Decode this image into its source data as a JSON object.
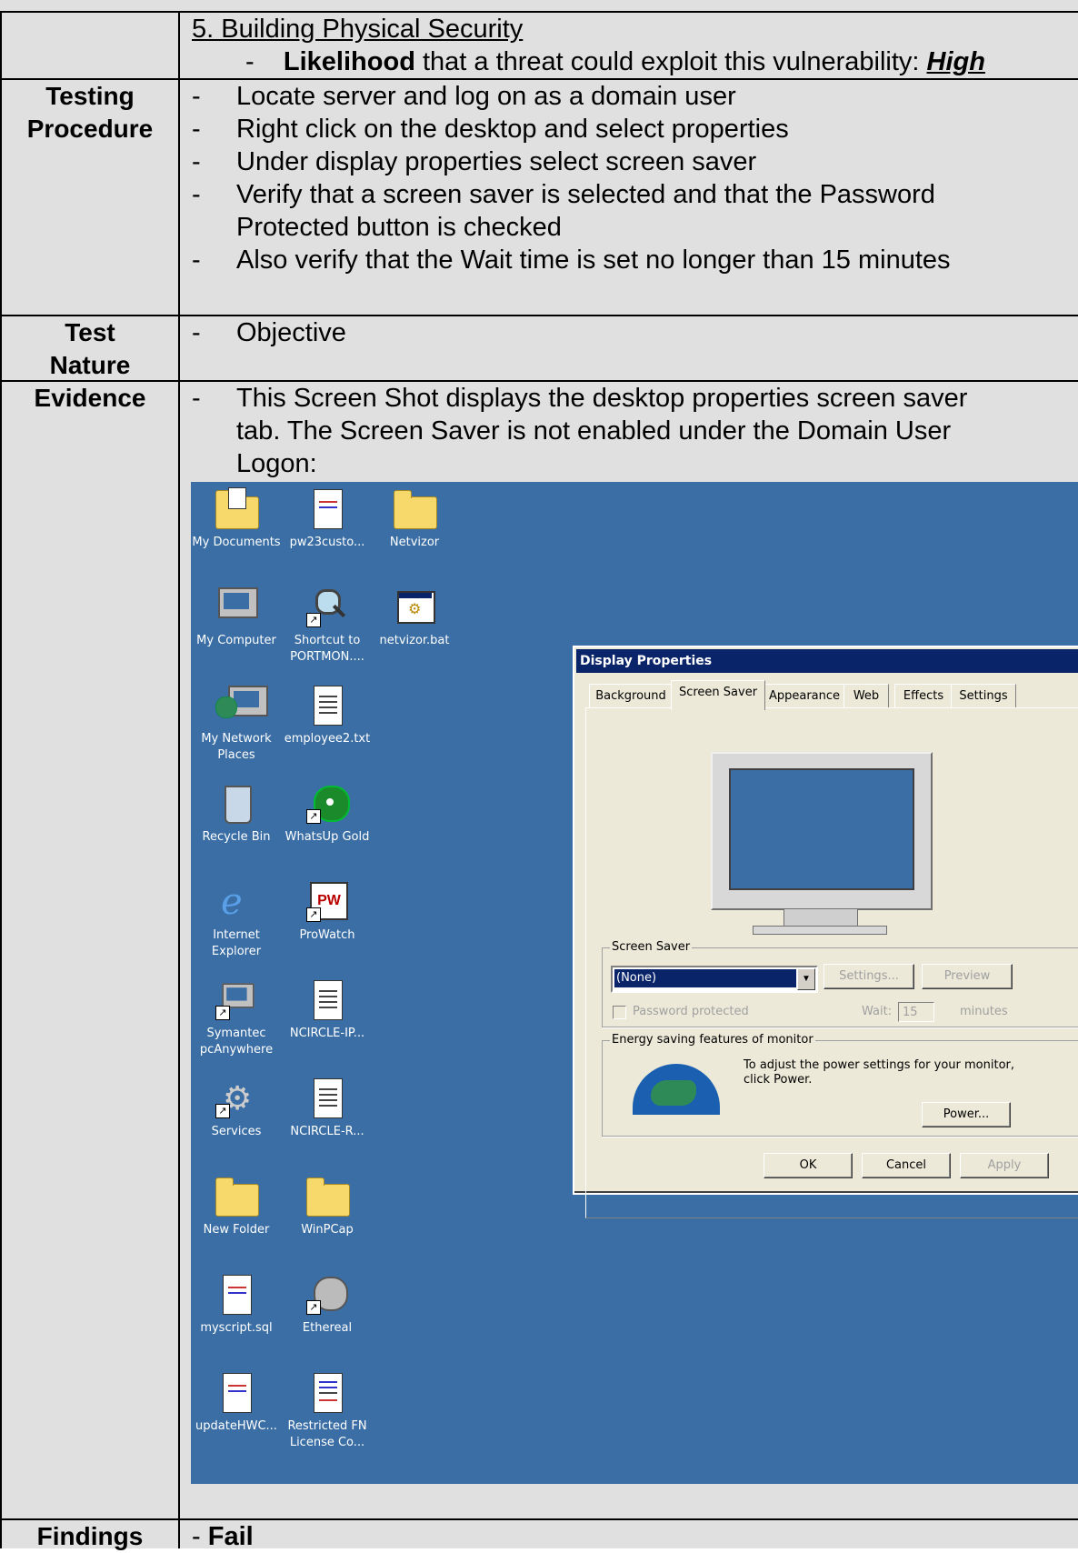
{
  "section_title": "5. Building Physical Security",
  "likelihood": {
    "dash": "-",
    "bold": "Likelihood",
    "text": "that a threat could exploit this vulnerability:",
    "value": "High"
  },
  "rows": {
    "testing": {
      "label_line1": "Testing",
      "label_line2": "Procedure",
      "items": [
        "Locate server and log on as a domain user",
        "Right click on the desktop and select properties",
        "Under display properties select screen saver",
        "Verify that a screen saver is selected and that the Password",
        "Protected button is checked",
        "Also verify that the Wait time is set no longer than 15 minutes"
      ]
    },
    "nature": {
      "label_line1": "Test",
      "label_line2": "Nature",
      "item": "Objective"
    },
    "evidence": {
      "label": "Evidence",
      "line1": "This Screen Shot displays the desktop properties screen saver",
      "line2": "tab. The Screen Saver is not enabled under the Domain User",
      "line3": "Logon:"
    },
    "findings": {
      "label": "Findings",
      "dash": "-",
      "value": "Fail"
    }
  },
  "dash": "-",
  "desktop_icons": [
    {
      "label": "My Documents",
      "icon": "my-documents-icon"
    },
    {
      "label": "pw23custo...",
      "icon": "document-icon"
    },
    {
      "label": "Netvizor",
      "icon": "folder-icon"
    },
    {
      "label": "My Computer",
      "icon": "my-computer-icon"
    },
    {
      "label": "Shortcut to PORTMON....",
      "icon": "portmon-shortcut-icon"
    },
    {
      "label": "netvizor.bat",
      "icon": "batch-file-icon"
    },
    {
      "label": "My Network Places",
      "icon": "network-places-icon"
    },
    {
      "label": "employee2.txt",
      "icon": "text-file-icon"
    },
    {
      "label": "Recycle Bin",
      "icon": "recycle-bin-icon"
    },
    {
      "label": "WhatsUp Gold",
      "icon": "whatsup-gold-icon"
    },
    {
      "label": "Internet Explorer",
      "icon": "internet-explorer-icon"
    },
    {
      "label": "ProWatch",
      "icon": "prowatch-icon"
    },
    {
      "label": "Symantec pcAnywhere",
      "icon": "pcanywhere-icon"
    },
    {
      "label": "NCIRCLE-IP...",
      "icon": "text-file-icon"
    },
    {
      "label": "Services",
      "icon": "services-icon"
    },
    {
      "label": "NCIRCLE-R...",
      "icon": "text-file-icon"
    },
    {
      "label": "New Folder",
      "icon": "folder-icon"
    },
    {
      "label": "WinPCap",
      "icon": "folder-icon"
    },
    {
      "label": "myscript.sql",
      "icon": "document-icon"
    },
    {
      "label": "Ethereal",
      "icon": "ethereal-icon"
    },
    {
      "label": "updateHWC...",
      "icon": "document-icon"
    },
    {
      "label": "Restricted FN License Co...",
      "icon": "license-document-icon"
    }
  ],
  "dialog": {
    "title": "Display Properties",
    "help": "?",
    "tabs": [
      "Background",
      "Screen Saver",
      "Appearance",
      "Web",
      "Effects",
      "Settings"
    ],
    "screen_saver_group": "Screen Saver",
    "screen_saver_value": "(None)",
    "settings_button": "Settings...",
    "preview_button": "Preview",
    "password_label": "Password protected",
    "wait_label": "Wait:",
    "wait_value": "15",
    "minutes_label": "minutes",
    "energy_group": "Energy saving features of monitor",
    "energy_text_1": "To adjust the power settings for your monitor,",
    "energy_text_2": "click Power.",
    "power_button": "Power...",
    "ok_button": "OK",
    "cancel_button": "Cancel",
    "apply_button": "Apply"
  }
}
